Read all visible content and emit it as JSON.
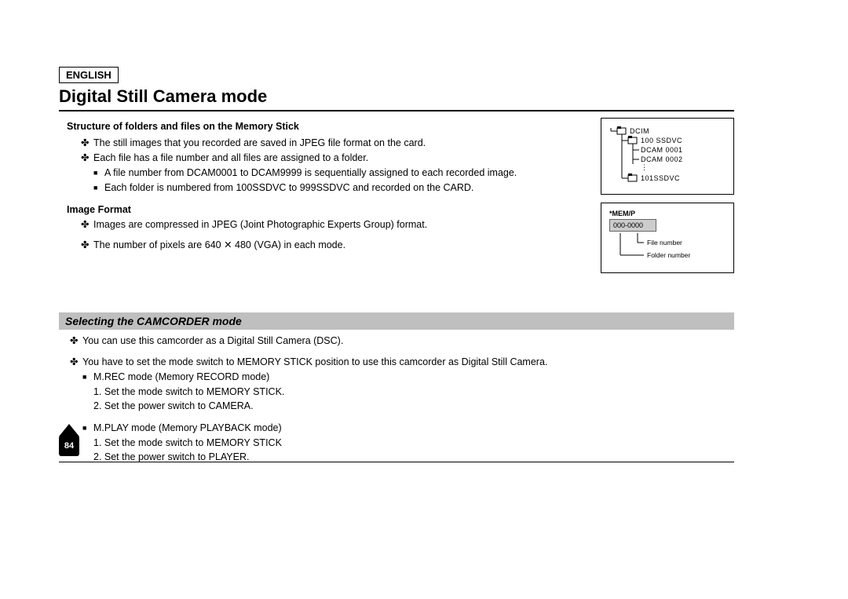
{
  "lang": "ENGLISH",
  "title": "Digital Still Camera mode",
  "section1_head": "Structure of folders and files on the Memory Stick",
  "b1": "The still images that you recorded are saved in JPEG file format on the card.",
  "b2": "Each file has a file number and all files are assigned to a folder.",
  "b2a": "A file number from DCAM0001 to DCAM9999 is sequentially assigned to each recorded image.",
  "b2b": "Each folder is numbered from 100SSDVC to 999SSDVC and recorded on the CARD.",
  "imgfmt_head": "Image Format",
  "if1": "Images are compressed in JPEG (Joint Photographic Experts Group) format.",
  "if2": "The number of pixels are 640 ✕ 480 (VGA) in each mode.",
  "banner": "Selecting the CAMCORDER mode",
  "c1": "You can use this camcorder as a Digital Still Camera (DSC).",
  "c2": "You have to set the mode switch to MEMORY STICK position to use this camcorder as Digital Still Camera.",
  "c2a_head": "M.REC mode (Memory RECORD mode)",
  "c2a_1": "1. Set the mode switch to MEMORY STICK.",
  "c2a_2": "2. Set the power switch to CAMERA.",
  "c2b_head": "M.PLAY mode (Memory PLAYBACK mode)",
  "c2b_1": "1. Set the mode switch to MEMORY STICK",
  "c2b_2": "2. Set the power switch to PLAYER.",
  "tree": {
    "root": "DCIM",
    "f1": "100 SSDVC",
    "f1a": "DCAM 0001",
    "f1b": "DCAM 0002",
    "f2": "101SSDVC"
  },
  "diag2": {
    "head": "*MEM/P",
    "box": "000-0000",
    "anno1": "File number",
    "anno2": "Folder number"
  },
  "pagenum": "84"
}
